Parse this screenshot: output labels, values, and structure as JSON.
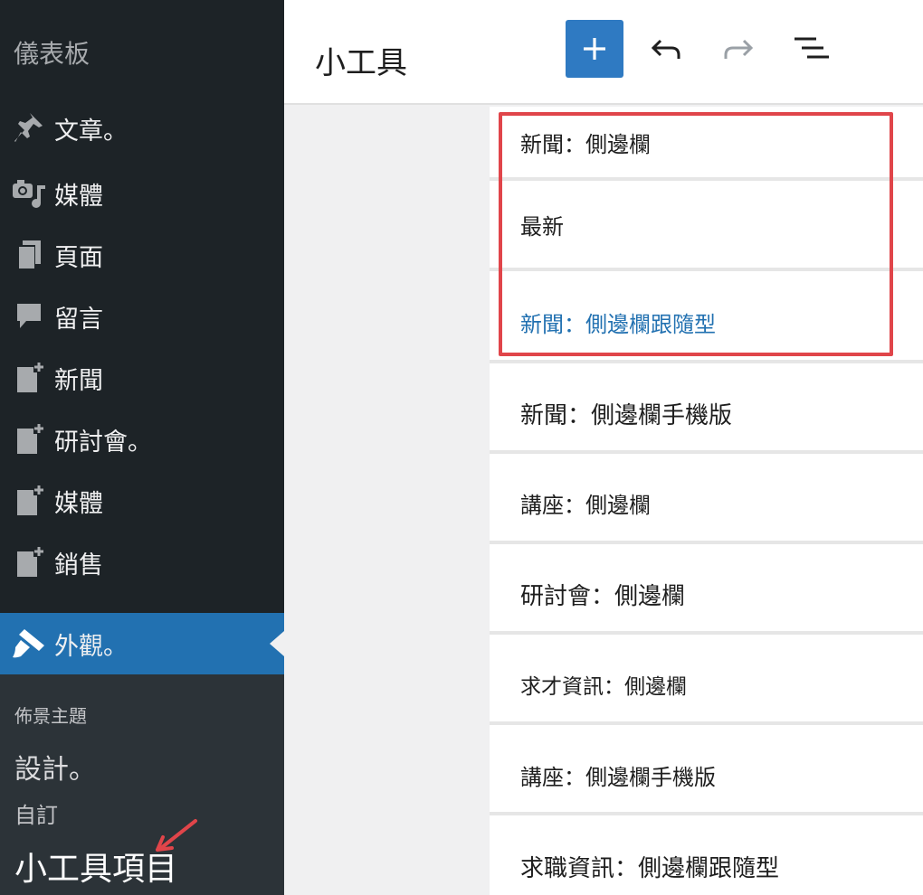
{
  "sidebar": {
    "dashboard": "儀表板",
    "items": [
      {
        "label": "文章。",
        "icon": "pin-icon"
      },
      {
        "label": "媒體",
        "icon": "media-icon"
      },
      {
        "label": "頁面",
        "icon": "pages-icon"
      },
      {
        "label": "留言",
        "icon": "comments-icon"
      },
      {
        "label": "新聞",
        "icon": "post-add-icon"
      },
      {
        "label": "研討會。",
        "icon": "post-add-icon"
      },
      {
        "label": "媒體",
        "icon": "post-add-icon"
      },
      {
        "label": "銷售",
        "icon": "post-add-icon"
      }
    ],
    "active": {
      "label": "外觀。",
      "icon": "brush-icon"
    },
    "submenu": [
      "佈景主題",
      "設計。",
      "自訂",
      "小工具項目"
    ]
  },
  "header": {
    "title": "小工具",
    "add_icon": "plus-icon",
    "undo_icon": "undo-icon",
    "redo_icon": "redo-icon",
    "list_view_icon": "list-view-icon"
  },
  "widget_areas": [
    "新聞：側邊欄",
    "最新",
    "新聞：側邊欄跟隨型",
    "新聞：側邊欄手機版",
    "講座：側邊欄",
    "研討會：側邊欄",
    "求才資訊：側邊欄",
    "講座：側邊欄手機版",
    "求職資訊：側邊欄跟隨型"
  ],
  "colors": {
    "sidebar_bg": "#1d2327",
    "active_bg": "#2271b1",
    "highlight_text": "#2271b1",
    "annotation_red": "#e0454a"
  }
}
